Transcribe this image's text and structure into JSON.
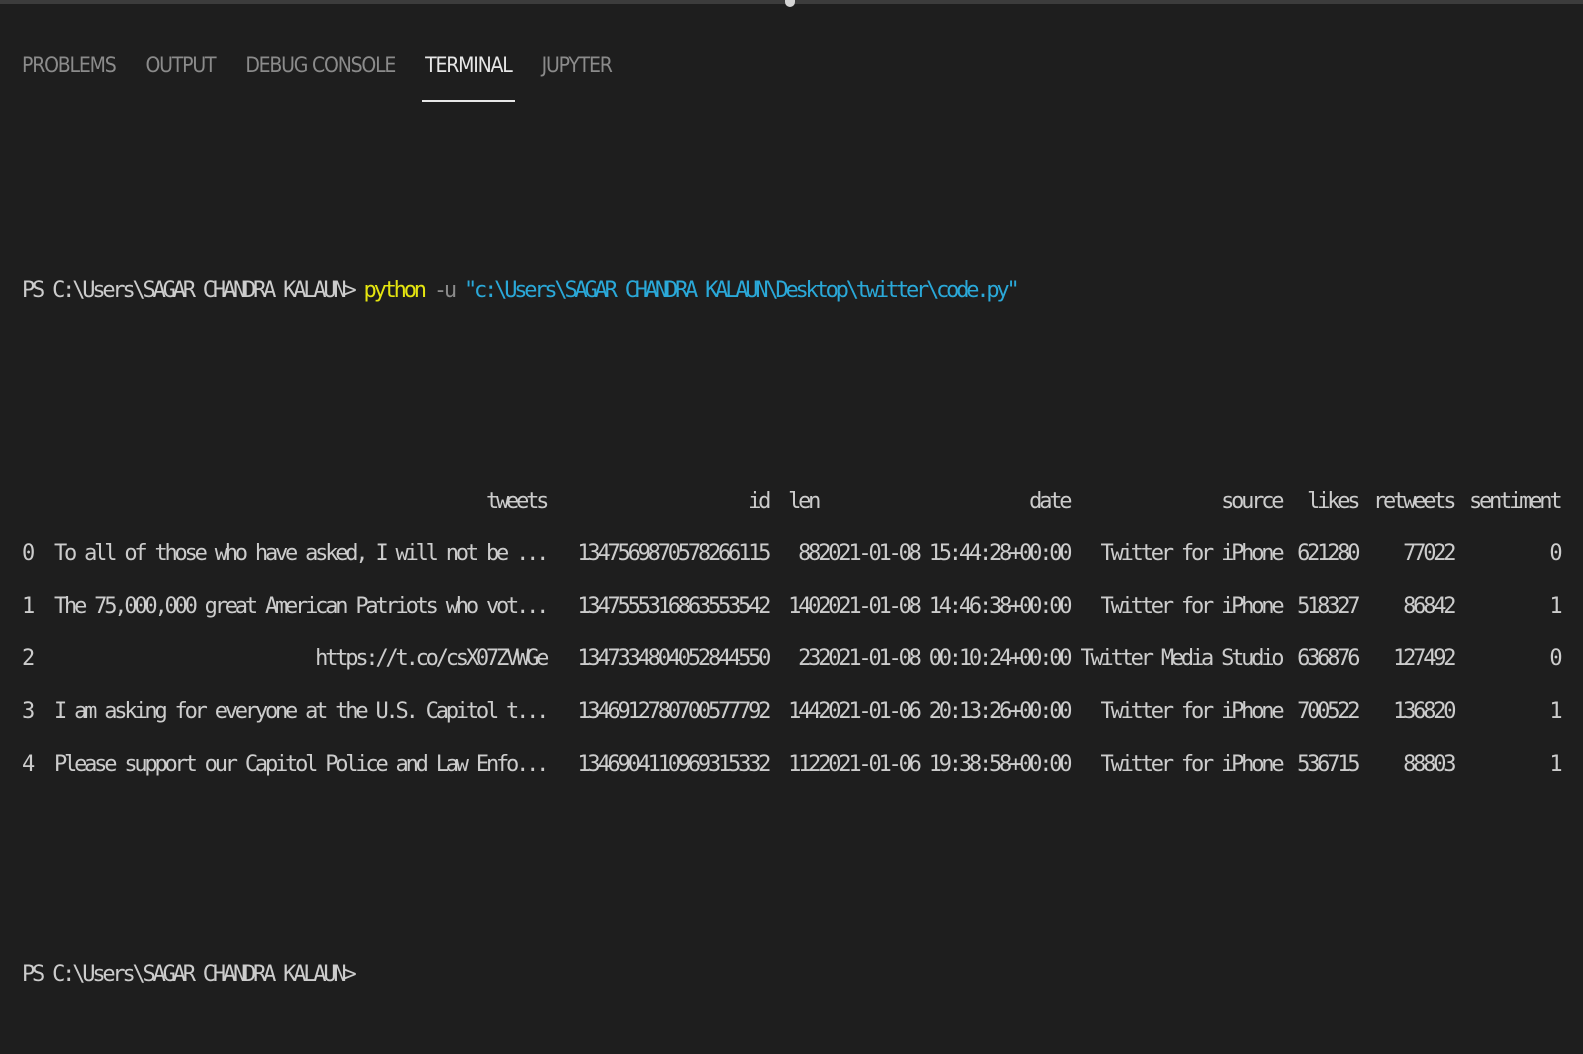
{
  "panel": {
    "tabs": [
      {
        "label": "PROBLEMS"
      },
      {
        "label": "OUTPUT"
      },
      {
        "label": "DEBUG CONSOLE"
      },
      {
        "label": "TERMINAL"
      },
      {
        "label": "JUPYTER"
      }
    ],
    "active_tab": "TERMINAL"
  },
  "terminal": {
    "prompt": "PS C:\\Users\\SAGAR CHANDRA KALAUN> ",
    "command": "python",
    "flag": " -u ",
    "arg": "\"c:\\Users\\SAGAR CHANDRA KALAUN\\Desktop\\twitter\\code.py\"",
    "table": {
      "headers": [
        "tweets",
        "id",
        "len",
        "date",
        "source",
        "likes",
        "retweets",
        "sentiment"
      ],
      "rows": [
        {
          "index": "0",
          "tweets": "To all of those who have asked, I will not be ...",
          "id": "1347569870578266115",
          "len": "88",
          "date": "2021-01-08 15:44:28+00:00",
          "source": "Twitter for iPhone",
          "likes": "621280",
          "retweets": "77022",
          "sentiment": "0"
        },
        {
          "index": "1",
          "tweets": "The 75,000,000 great American Patriots who vot...",
          "id": "1347555316863553542",
          "len": "140",
          "date": "2021-01-08 14:46:38+00:00",
          "source": "Twitter for iPhone",
          "likes": "518327",
          "retweets": "86842",
          "sentiment": "1"
        },
        {
          "index": "2",
          "tweets": "https://t.co/csX07ZVWGe",
          "id": "1347334804052844550",
          "len": "23",
          "date": "2021-01-08 00:10:24+00:00",
          "source": "Twitter Media Studio",
          "likes": "636876",
          "retweets": "127492",
          "sentiment": "0"
        },
        {
          "index": "3",
          "tweets": "I am asking for everyone at the U.S. Capitol t...",
          "id": "1346912780700577792",
          "len": "144",
          "date": "2021-01-06 20:13:26+00:00",
          "source": "Twitter for iPhone",
          "likes": "700522",
          "retweets": "136820",
          "sentiment": "1"
        },
        {
          "index": "4",
          "tweets": "Please support our Capitol Police and Law Enfo...",
          "id": "1346904110969315332",
          "len": "112",
          "date": "2021-01-06 19:38:58+00:00",
          "source": "Twitter for iPhone",
          "likes": "536715",
          "retweets": "88803",
          "sentiment": "1"
        }
      ]
    },
    "final_prompt": "PS C:\\Users\\SAGAR CHANDRA KALAUN>"
  }
}
